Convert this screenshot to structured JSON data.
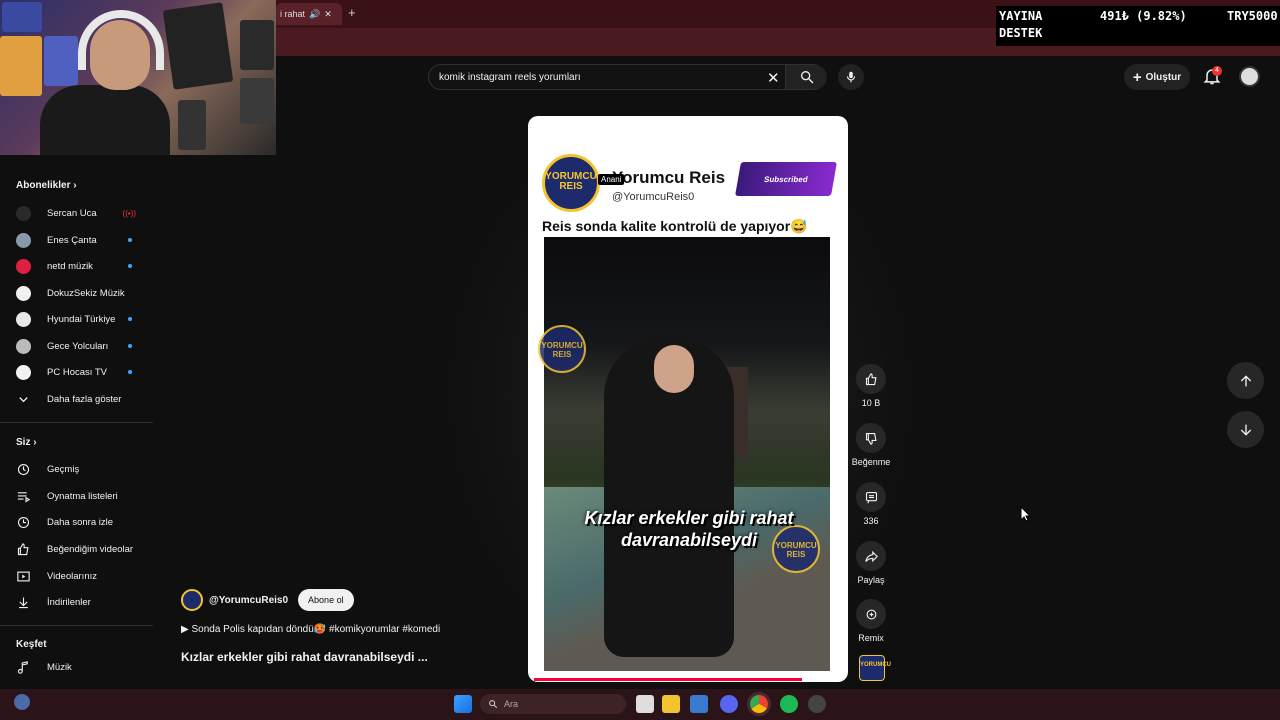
{
  "browser": {
    "tab_label": "i rahat",
    "new_tab": "+"
  },
  "donation": {
    "label_line1": "YAYINA",
    "label_line2": "DESTEK",
    "amount": "491₺ (9.82%)",
    "goal": "TRY5000"
  },
  "header": {
    "search_value": "komik instagram reels yorumları",
    "create_label": "Oluştur",
    "notification_count": "4"
  },
  "sidebar": {
    "subscriptions_title": "Abonelikler",
    "subscriptions": [
      {
        "name": "Sercan Uca",
        "color": "#2a2a2a",
        "status": "live"
      },
      {
        "name": "Enes Çanta",
        "color": "#8899aa",
        "status": "new"
      },
      {
        "name": "netd müzik",
        "color": "#e02040",
        "status": "new"
      },
      {
        "name": "DokuzSekiz Müzik",
        "color": "#f1f1f1",
        "status": "none"
      },
      {
        "name": "Hyundai Türkiye",
        "color": "#e8e8e8",
        "status": "new"
      },
      {
        "name": "Gece Yolcuları",
        "color": "#bbbbbb",
        "status": "new"
      },
      {
        "name": "PC Hocası TV",
        "color": "#f1f1f1",
        "status": "new"
      }
    ],
    "show_more": "Daha fazla göster",
    "you_title": "Siz",
    "you_items": [
      {
        "label": "Geçmiş",
        "icon": "history-icon"
      },
      {
        "label": "Oynatma listeleri",
        "icon": "playlist-icon"
      },
      {
        "label": "Daha sonra izle",
        "icon": "clock-icon"
      },
      {
        "label": "Beğendiğim videolar",
        "icon": "like-icon"
      },
      {
        "label": "Videolarınız",
        "icon": "video-icon"
      },
      {
        "label": "İndirilenler",
        "icon": "download-icon"
      }
    ],
    "explore_title": "Keşfet",
    "explore_items": [
      {
        "label": "Müzik",
        "icon": "music-icon"
      }
    ]
  },
  "short": {
    "logo_text": "YORUMCU REIS",
    "channel_name": "Yorumcu Reis",
    "channel_handle": "@YorumcuReis0",
    "tag": "Anani",
    "subscribed_badge": "Subscribed",
    "caption": "Reis sonda kalite kontrolü de yapıyor😅",
    "overlay_text": "Kızlar erkekler gibi rahat davranabilseydi",
    "watermark": "YORUMCU REIS"
  },
  "actions": {
    "likes": "10 B",
    "dislike": "Beğenme",
    "comments": "336",
    "share": "Paylaş",
    "remix": "Remix",
    "channel_thumb": "YORUMCU"
  },
  "info": {
    "channel_handle": "@YorumcuReis0",
    "subscribe_label": "Abone ol",
    "description": "▶ Sonda Polis kapıdan döndü🥵 #komikyorumlar #komedi",
    "title": "Kızlar erkekler gibi rahat davranabilseydi ..."
  },
  "taskbar": {
    "search_placeholder": "Ara"
  },
  "colors": {
    "accent_red": "#ff0033",
    "link_blue": "#3ea6ff",
    "background": "#0f0f0f"
  }
}
